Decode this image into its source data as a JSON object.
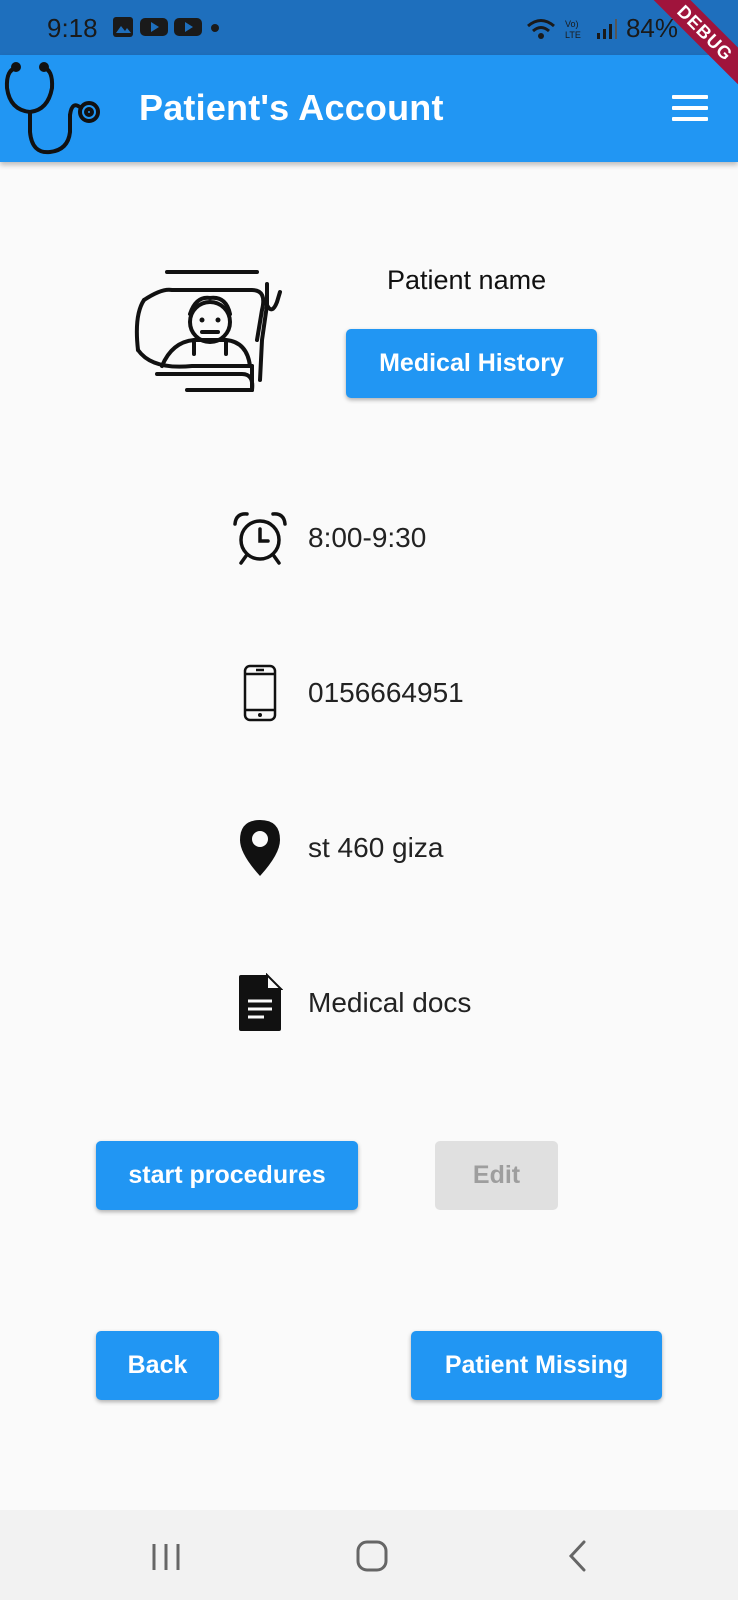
{
  "status_bar": {
    "time": "9:18",
    "battery": "84%"
  },
  "app_bar": {
    "title": "Patient's Account"
  },
  "debug_label": "DEBUG",
  "patient": {
    "name": "Patient name",
    "medical_history_label": "Medical History"
  },
  "info": {
    "time": "8:00-9:30",
    "phone": "0156664951",
    "address": "st 460 giza",
    "docs": "Medical docs"
  },
  "actions": {
    "start_label": "start procedures",
    "edit_label": "Edit",
    "back_label": "Back",
    "missing_label": "Patient Missing"
  },
  "colors": {
    "primary": "#2196f3",
    "status_bar": "#1e6fbd",
    "disabled": "#e0e0e0"
  },
  "icons": [
    "stethoscope-icon",
    "menu-icon",
    "patient-bed-icon",
    "alarm-clock-icon",
    "phone-icon",
    "location-pin-icon",
    "document-icon"
  ]
}
